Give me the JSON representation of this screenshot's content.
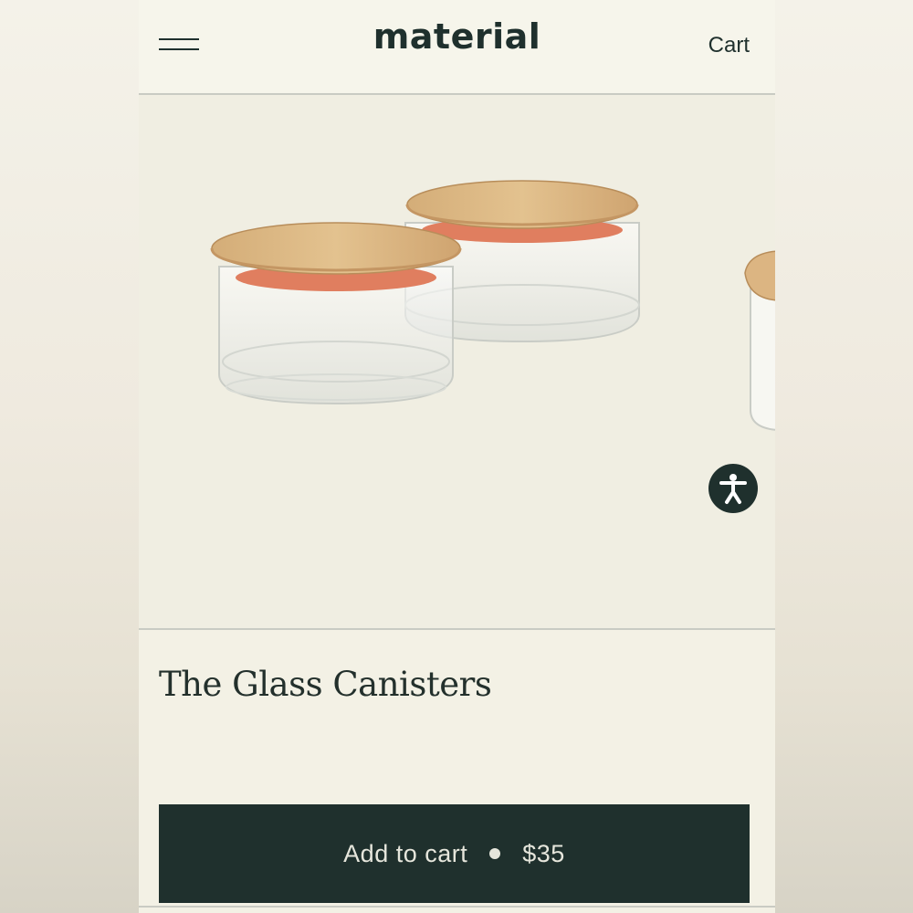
{
  "header": {
    "logo": "material",
    "cart_label": "Cart",
    "menu_icon": "hamburger-menu-icon"
  },
  "product": {
    "title": "The Glass Canisters",
    "image_subject": "glass canisters with bamboo lids",
    "accessibility_icon": "accessibility-person-icon"
  },
  "cta": {
    "label": "Add to cart",
    "separator_icon": "dot-icon",
    "price": "$35"
  },
  "colors": {
    "brand_dark": "#1f302d",
    "page_background": "#f3f1e5",
    "button_text": "#e6e6dc"
  }
}
